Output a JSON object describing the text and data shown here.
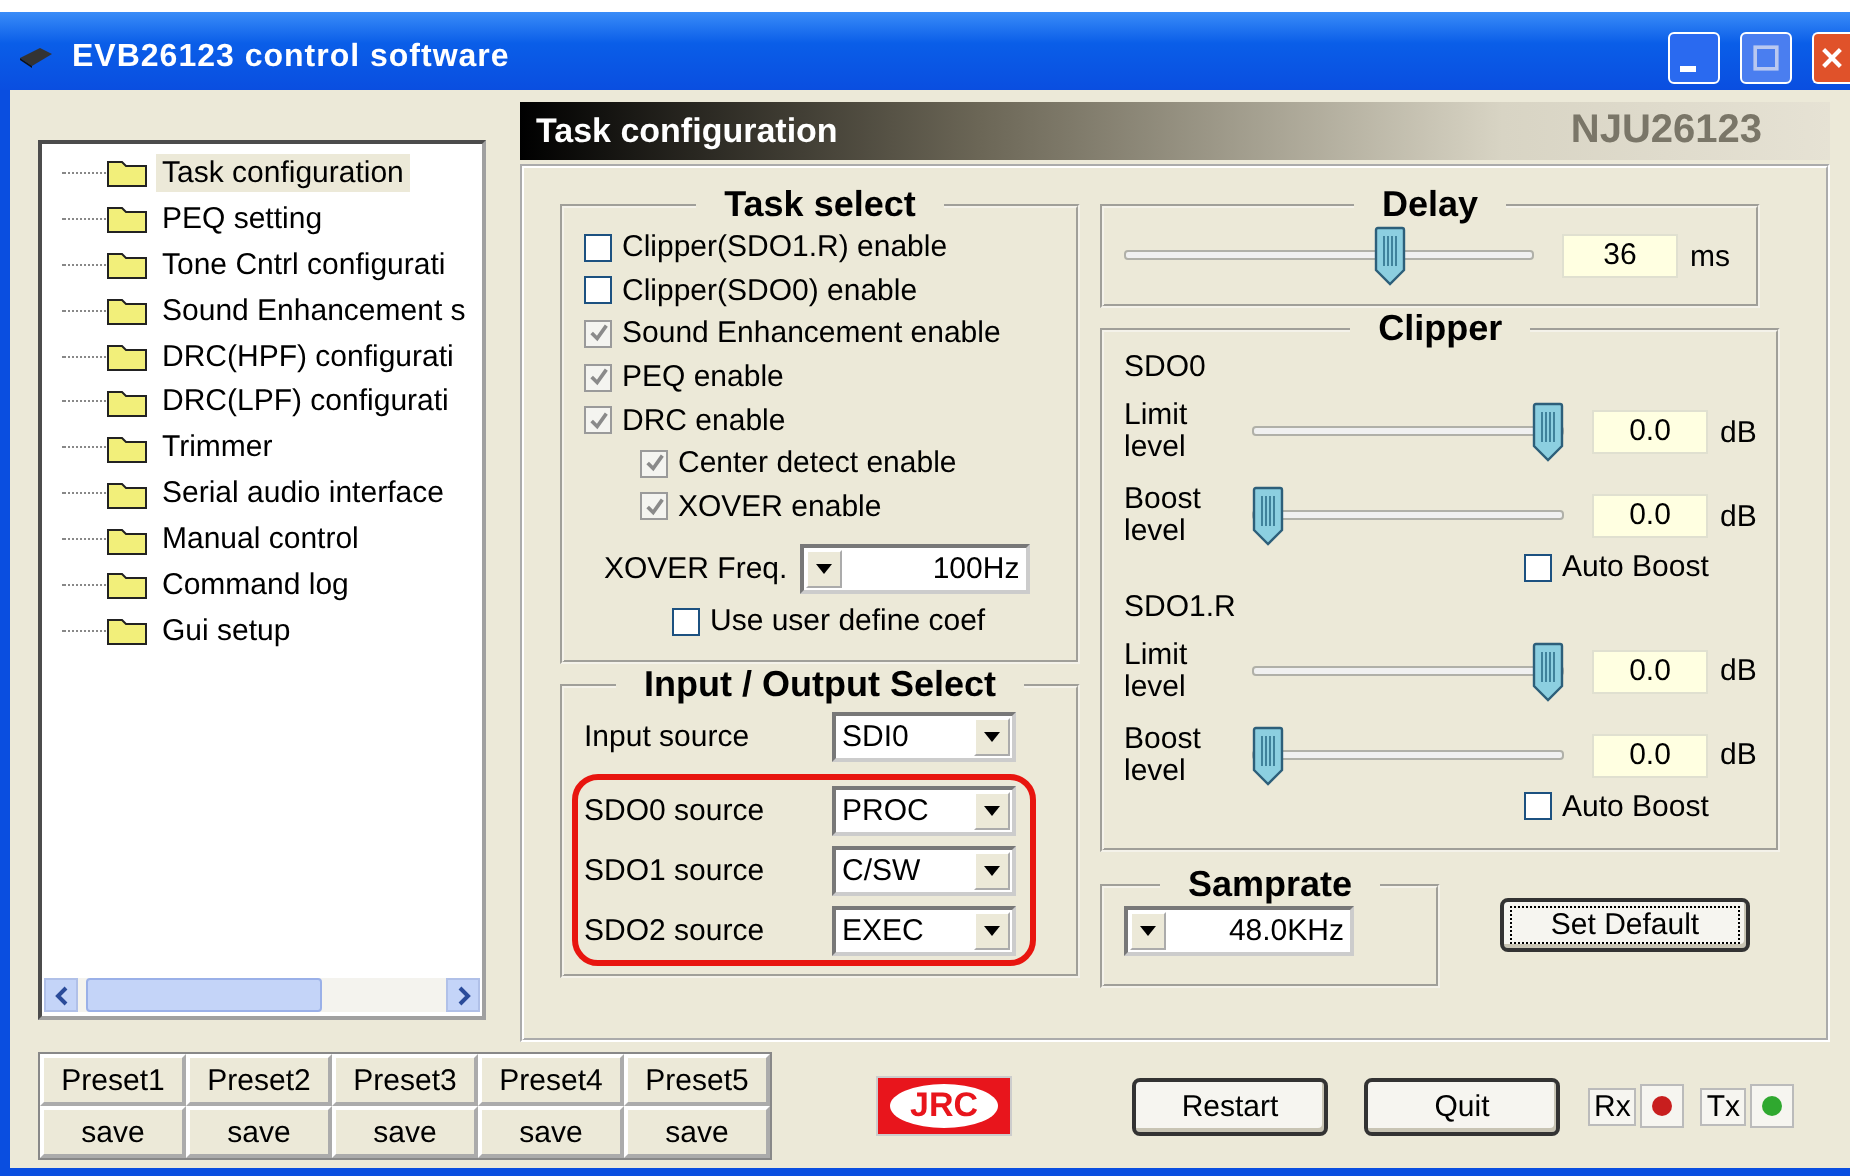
{
  "window": {
    "title": "EVB26123 control software"
  },
  "tree": {
    "items": [
      {
        "label": "Task configuration",
        "selected": true
      },
      {
        "label": "PEQ setting",
        "selected": false
      },
      {
        "label": "Tone Cntrl configurati",
        "selected": false
      },
      {
        "label": "Sound Enhancement s",
        "selected": false
      },
      {
        "label": "DRC(HPF) configurati",
        "selected": false
      },
      {
        "label": "DRC(LPF) configurati",
        "selected": false
      },
      {
        "label": "Trimmer",
        "selected": false
      },
      {
        "label": "Serial audio interface",
        "selected": false
      },
      {
        "label": "Manual control",
        "selected": false
      },
      {
        "label": "Command log",
        "selected": false
      },
      {
        "label": "Gui setup",
        "selected": false
      }
    ]
  },
  "header": {
    "title": "Task configuration",
    "device": "NJU26123"
  },
  "task_select": {
    "title": "Task select",
    "options": [
      {
        "label": "Clipper(SDO1.R) enable",
        "checked": false
      },
      {
        "label": "Clipper(SDO0) enable",
        "checked": false
      },
      {
        "label": "Sound Enhancement enable",
        "checked": true
      },
      {
        "label": "PEQ enable",
        "checked": true
      },
      {
        "label": "DRC enable",
        "checked": true,
        "children": [
          {
            "label": "Center detect enable",
            "checked": true
          },
          {
            "label": "XOVER enable",
            "checked": true
          }
        ]
      }
    ],
    "xover": {
      "label": "XOVER Freq.",
      "value": "100Hz"
    },
    "user_coef": {
      "label": "Use user define coef",
      "checked": false
    }
  },
  "io": {
    "title": "Input / Output Select",
    "rows": [
      {
        "label": "Input source",
        "value": "SDI0",
        "highlighted": false
      },
      {
        "label": "SDO0 source",
        "value": "PROC",
        "highlighted": true
      },
      {
        "label": "SDO1 source",
        "value": "C/SW",
        "highlighted": true
      },
      {
        "label": "SDO2 source",
        "value": "EXEC",
        "highlighted": true
      }
    ]
  },
  "delay": {
    "title": "Delay",
    "level": 0.66,
    "value": "36",
    "unit": "ms"
  },
  "clipper": {
    "title": "Clipper",
    "channels": [
      {
        "name": "SDO0",
        "sliders": [
          {
            "label": "Limit level",
            "level": 1.0,
            "value": "0.0",
            "unit": "dB"
          },
          {
            "label": "Boost level",
            "level": 0.0,
            "value": "0.0",
            "unit": "dB"
          }
        ],
        "auto_boost": {
          "label": "Auto Boost",
          "checked": false
        }
      },
      {
        "name": "SDO1.R",
        "sliders": [
          {
            "label": "Limit level",
            "level": 1.0,
            "value": "0.0",
            "unit": "dB"
          },
          {
            "label": "Boost level",
            "level": 0.0,
            "value": "0.0",
            "unit": "dB"
          }
        ],
        "auto_boost": {
          "label": "Auto Boost",
          "checked": false
        }
      }
    ]
  },
  "samprate": {
    "title": "Samprate",
    "value": "48.0KHz"
  },
  "set_default": "Set Default",
  "presets": [
    {
      "label": "Preset1",
      "save": "save"
    },
    {
      "label": "Preset2",
      "save": "save"
    },
    {
      "label": "Preset3",
      "save": "save"
    },
    {
      "label": "Preset4",
      "save": "save"
    },
    {
      "label": "Preset5",
      "save": "save"
    }
  ],
  "logo": "JRC",
  "buttons": [
    "Restart",
    "Quit"
  ],
  "indicators": [
    {
      "label": "Rx",
      "color": "#c81e1e"
    },
    {
      "label": "Tx",
      "color": "#2fa82f"
    }
  ]
}
